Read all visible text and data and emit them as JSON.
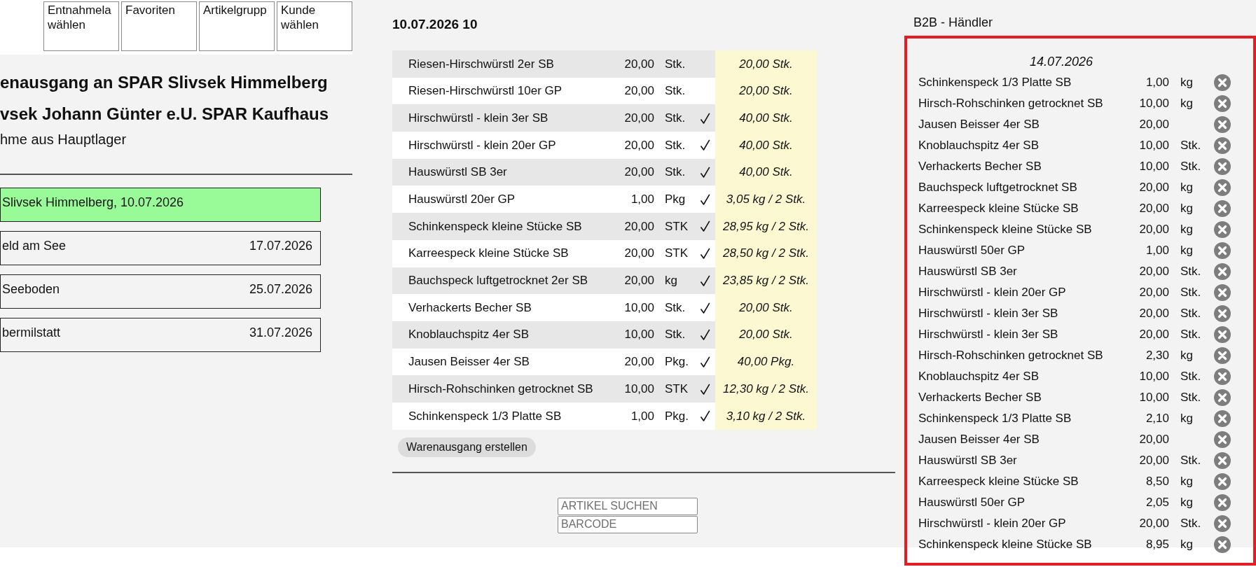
{
  "toolbar": {
    "buttons": [
      {
        "lines": [
          "Entnahmela",
          "wählen"
        ]
      },
      {
        "lines": [
          "Favoriten"
        ]
      },
      {
        "lines": [
          "Artikelgrupp"
        ]
      },
      {
        "lines": [
          "Kunde",
          "wählen"
        ]
      }
    ]
  },
  "header": {
    "title_lines": [
      "enausgang an SPAR Slivsek Himmelberg",
      "vsek Johann Günter e.U. SPAR Kaufhaus"
    ],
    "subtitle": "hme aus Hauptlager"
  },
  "deliveries": [
    {
      "label": "Slivsek Himmelberg, 10.07.2026",
      "selected": true
    },
    {
      "label": "eld am See",
      "date": "17.07.2026",
      "selected": false
    },
    {
      "label": "Seeboden",
      "date": "25.07.2026",
      "selected": false
    },
    {
      "label": "bermilstatt",
      "date": "31.07.2026",
      "selected": false
    }
  ],
  "order": {
    "title": "10.07.2026 10",
    "rows": [
      {
        "article": "Riesen-Hirschwürstl 2er SB",
        "quantity": "20,00",
        "unit": "Stk.",
        "checked": false,
        "total": "20,00 Stk."
      },
      {
        "article": "Riesen-Hirschwürstl 10er GP",
        "quantity": "20,00",
        "unit": "Stk.",
        "checked": false,
        "total": "20,00 Stk."
      },
      {
        "article": "Hirschwürstl - klein 3er SB",
        "quantity": "20,00",
        "unit": "Stk.",
        "checked": true,
        "total": "40,00 Stk."
      },
      {
        "article": "Hirschwürstl - klein 20er GP",
        "quantity": "20,00",
        "unit": "Stk.",
        "checked": true,
        "total": "40,00 Stk."
      },
      {
        "article": "Hauswürstl SB 3er",
        "quantity": "20,00",
        "unit": "Stk.",
        "checked": true,
        "total": "40,00 Stk."
      },
      {
        "article": "Hauswürstl 20er GP",
        "quantity": "1,00",
        "unit": "Pkg",
        "checked": true,
        "total": "3,05 kg / 2 Stk."
      },
      {
        "article": "Schinkenspeck kleine Stücke SB",
        "quantity": "20,00",
        "unit": "STK",
        "checked": true,
        "total": "28,95 kg / 2 Stk."
      },
      {
        "article": "Karreespeck kleine Stücke SB",
        "quantity": "20,00",
        "unit": "STK",
        "checked": true,
        "total": "28,50 kg / 2 Stk."
      },
      {
        "article": "Bauchspeck luftgetrocknet 2er SB",
        "quantity": "20,00",
        "unit": "kg",
        "checked": true,
        "total": "23,85 kg / 2 Stk."
      },
      {
        "article": "Verhackerts Becher SB",
        "quantity": "10,00",
        "unit": "Stk.",
        "checked": true,
        "total": "20,00 Stk."
      },
      {
        "article": "Knoblauchspitz 4er SB",
        "quantity": "10,00",
        "unit": "Stk.",
        "checked": true,
        "total": "20,00 Stk."
      },
      {
        "article": "Jausen Beisser 4er SB",
        "quantity": "20,00",
        "unit": "Pkg.",
        "checked": true,
        "total": "40,00 Pkg."
      },
      {
        "article": "Hirsch-Rohschinken getrocknet SB",
        "quantity": "10,00",
        "unit": "STK",
        "checked": true,
        "total": "12,30 kg / 2 Stk."
      },
      {
        "article": "Schinkenspeck 1/3 Platte SB",
        "quantity": "1,00",
        "unit": "Pkg.",
        "checked": true,
        "total": "3,10 kg / 2 Stk."
      }
    ],
    "button": "Warenausgang erstellen"
  },
  "search": {
    "fields": [
      {
        "placeholder": "ARTIKEL SUCHEN"
      },
      {
        "placeholder": "BARCODE"
      }
    ]
  },
  "cart": {
    "title": "B2B - Händler",
    "date": "14.07.2026",
    "items": [
      {
        "article": "Schinkenspeck 1/3 Platte SB",
        "quantity": "1,00",
        "unit": "kg"
      },
      {
        "article": "Hirsch-Rohschinken getrocknet SB",
        "quantity": "10,00",
        "unit": "kg"
      },
      {
        "article": "Jausen Beisser 4er SB",
        "quantity": "20,00"
      },
      {
        "article": "Knoblauchspitz 4er SB",
        "quantity": "10,00",
        "unit": "Stk."
      },
      {
        "article": "Verhackerts Becher SB",
        "quantity": "10,00",
        "unit": "Stk."
      },
      {
        "article": "Bauchspeck luftgetrocknet SB",
        "quantity": "20,00",
        "unit": "kg"
      },
      {
        "article": "Karreespeck kleine Stücke SB",
        "quantity": "20,00",
        "unit": "kg"
      },
      {
        "article": "Schinkenspeck kleine Stücke SB",
        "quantity": "20,00",
        "unit": "kg"
      },
      {
        "article": "Hauswürstl 50er GP",
        "quantity": "1,00",
        "unit": "kg"
      },
      {
        "article": "Hauswürstl SB 3er",
        "quantity": "20,00",
        "unit": "Stk."
      },
      {
        "article": "Hirschwürstl - klein 20er GP",
        "quantity": "20,00",
        "unit": "Stk."
      },
      {
        "article": "Hirschwürstl - klein 3er SB",
        "quantity": "20,00",
        "unit": "Stk."
      },
      {
        "article": "Hirschwürstl - klein 3er SB",
        "quantity": "20,00",
        "unit": "Stk."
      },
      {
        "article": "Hirsch-Rohschinken getrocknet SB",
        "quantity": "2,30",
        "unit": "kg"
      },
      {
        "article": "Knoblauchspitz 4er SB",
        "quantity": "10,00",
        "unit": "Stk."
      },
      {
        "article": "Verhackerts Becher SB",
        "quantity": "10,00",
        "unit": "Stk."
      },
      {
        "article": "Schinkenspeck 1/3 Platte SB",
        "quantity": "2,10",
        "unit": "kg"
      },
      {
        "article": "Jausen Beisser 4er SB",
        "quantity": "20,00"
      },
      {
        "article": "Hauswürstl SB 3er",
        "quantity": "20,00",
        "unit": "Stk."
      },
      {
        "article": "Karreespeck kleine Stücke SB",
        "quantity": "8,50",
        "unit": "kg"
      },
      {
        "article": "Hauswürstl 50er GP",
        "quantity": "2,05",
        "unit": "kg"
      },
      {
        "article": "Hirschwürstl - klein 20er GP",
        "quantity": "20,00",
        "unit": "Stk."
      },
      {
        "article": "Schinkenspeck kleine Stücke SB",
        "quantity": "8,95",
        "unit": "kg"
      }
    ]
  }
}
